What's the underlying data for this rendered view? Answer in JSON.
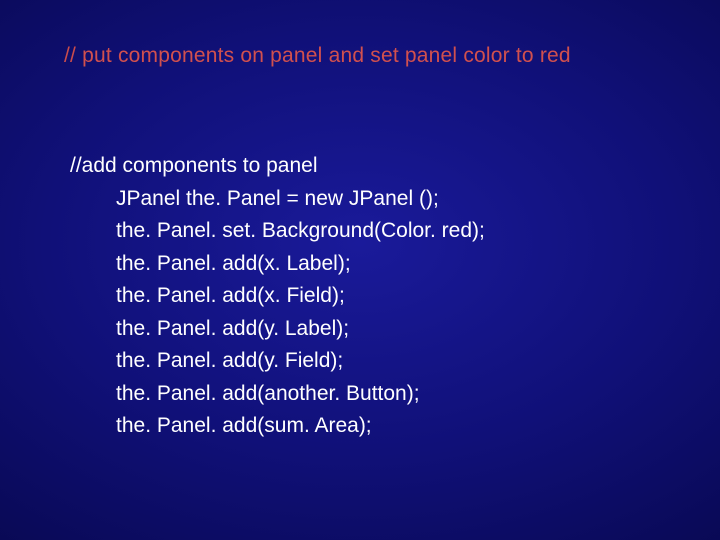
{
  "title": {
    "slashes": "//",
    "text": "  put components on panel and set panel color to red"
  },
  "code": {
    "comment": "//add components to panel",
    "lines": [
      "JPanel the. Panel = new JPanel ();",
      "the. Panel. set. Background(Color. red);",
      "the. Panel. add(x. Label);",
      "the. Panel. add(x. Field);",
      "the. Panel. add(y. Label);",
      "the. Panel. add(y. Field);",
      "the. Panel. add(another. Button);",
      "the. Panel. add(sum. Area);"
    ]
  }
}
